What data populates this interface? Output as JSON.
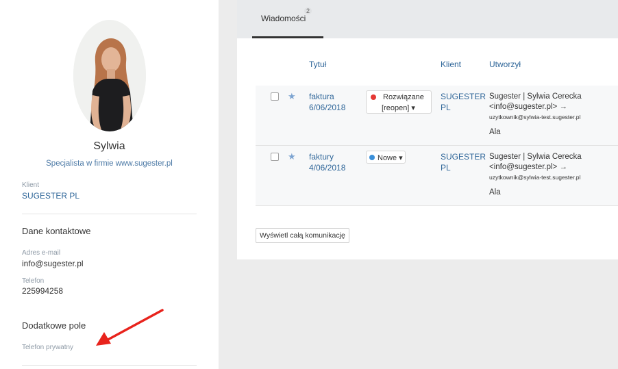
{
  "profile": {
    "name": "Sylwia",
    "role": "Specjalista w firmie www.sugester.pl",
    "client_label": "Klient",
    "client_value": "SUGESTER PL",
    "contact_heading": "Dane kontaktowe",
    "email_label": "Adres e-mail",
    "email_value": "info@sugester.pl",
    "phone_label": "Telefon",
    "phone_value": "225994258",
    "extra_heading": "Dodatkowe pole",
    "private_phone_label": "Telefon prywatny"
  },
  "tabs": [
    {
      "label": "Wiadomości",
      "count": "2"
    }
  ],
  "table": {
    "headers": {
      "title": "Tytuł",
      "client": "Klient",
      "created_by": "Utworzył"
    },
    "rows": [
      {
        "title_line1": "faktura",
        "title_line2": "6/06/2018",
        "status_line1": "Rozwiązane",
        "status_line2": "[reopen] ▾",
        "status_color": "#e53935",
        "client_line1": "SUGESTER",
        "client_line2": "PL",
        "by_line1": "Sugester | Sylwia Cerecka",
        "by_line2": "<info@sugester.pl> →",
        "by_line3": "uzytkownik@sylwia-test.sugester.pl",
        "assignee": "Ala"
      },
      {
        "title_line1": "faktury",
        "title_line2": "4/06/2018",
        "status_line1": "Nowe ▾",
        "status_line2": "",
        "status_color": "#3a8fd9",
        "client_line1": "SUGESTER",
        "client_line2": "PL",
        "by_line1": "Sugester | Sylwia Cerecka",
        "by_line2": "<info@sugester.pl> →",
        "by_line3": "uzytkownik@sylwia-test.sugester.pl",
        "assignee": "Ala"
      }
    ]
  },
  "show_all_button": "Wyświetl całą komunikację",
  "colors": {
    "accent": "#2f6699",
    "annotation_arrow": "#e8231c"
  }
}
